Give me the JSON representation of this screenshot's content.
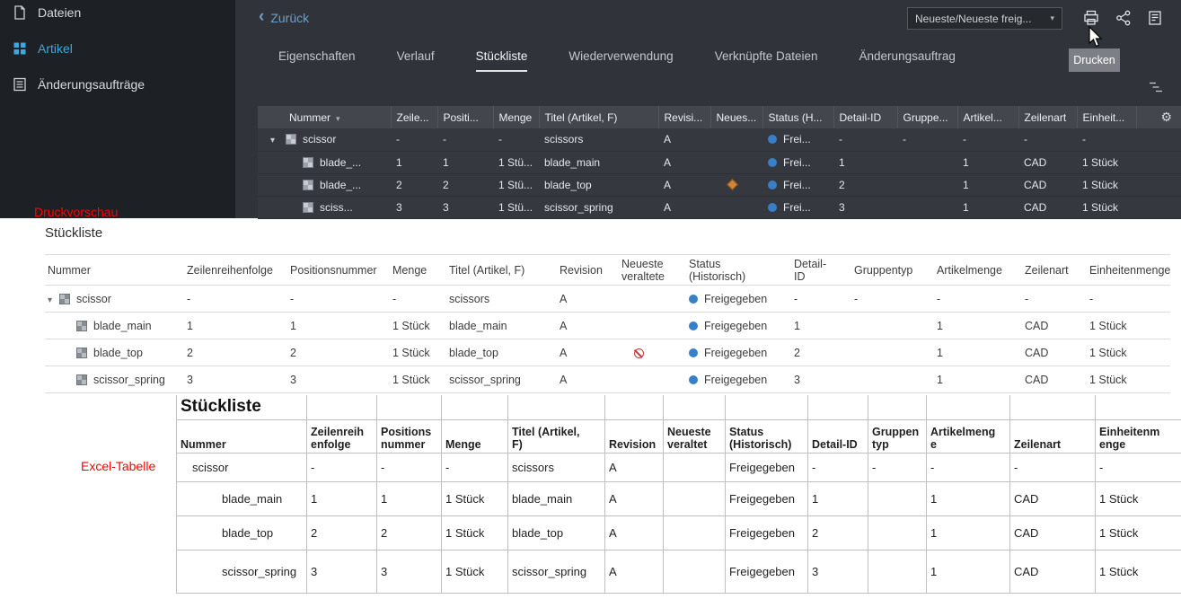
{
  "sidebar": {
    "items": [
      {
        "label": "Dateien"
      },
      {
        "label": "Artikel",
        "active": true
      },
      {
        "label": "Änderungsaufträge"
      }
    ]
  },
  "toolbar": {
    "back_label": "Zurück",
    "revision_rule": "Neueste/Neueste freig...",
    "print_tooltip": "Drucken"
  },
  "tabs": [
    {
      "label": "Eigenschaften"
    },
    {
      "label": "Verlauf"
    },
    {
      "label": "Stückliste",
      "active": true
    },
    {
      "label": "Wiederverwendung"
    },
    {
      "label": "Verknüpfte Dateien"
    },
    {
      "label": "Änderungsauftrag"
    }
  ],
  "annotations": {
    "print_preview_label": "Druckvorschau",
    "excel_label": "Excel-Tabelle"
  },
  "icons": {
    "back_chevron": "‹",
    "caret_down": "▾",
    "gear": "⚙",
    "item": "grid-2x2",
    "status_released": "blue-dot",
    "obsolete_dark": "orange-diamond",
    "obsolete_preview": "red-circle-slash",
    "print": "printer",
    "share": "share-nodes",
    "report": "document-lines",
    "hierarchy_toggle": "tree-lines",
    "cursor": "arrow-pointer"
  },
  "colors": {
    "accent_blue": "#3fa7e0",
    "status_blue": "#377fc7",
    "annotation_red": "#ff0000",
    "obsolete_red": "#c23b3b",
    "obsolete_orange": "#cd853f"
  },
  "bom_table": {
    "columns": [
      "Nummer",
      "Zeile...",
      "Positi...",
      "Menge",
      "Titel (Artikel, F)",
      "Revisi...",
      "Neues...",
      "Status (H...",
      "Detail-ID",
      "Gruppe...",
      "Artikel...",
      "Zeilenart",
      "Einheit..."
    ],
    "rows": [
      {
        "cells": [
          "scissor",
          "-",
          "-",
          "-",
          "scissors",
          "A",
          "",
          "Frei...",
          "-",
          "-",
          "-",
          "-",
          "-"
        ]
      },
      {
        "cells": [
          "blade_...",
          "1",
          "1",
          "1 Stü...",
          "blade_main",
          "A",
          "",
          "Frei...",
          "1",
          "",
          "1",
          "CAD",
          "1 Stück"
        ]
      },
      {
        "cells": [
          "blade_...",
          "2",
          "2",
          "1 Stü...",
          "blade_top",
          "A",
          "",
          "Frei...",
          "2",
          "",
          "1",
          "CAD",
          "1 Stück"
        ]
      },
      {
        "cells": [
          "sciss...",
          "3",
          "3",
          "1 Stü...",
          "scissor_spring",
          "A",
          "",
          "Frei...",
          "3",
          "",
          "1",
          "CAD",
          "1 Stück"
        ]
      }
    ]
  },
  "print_preview": {
    "title": "Stückliste",
    "columns": [
      "Nummer",
      "Zeilenreihenfolge",
      "Positionsnummer",
      "Menge",
      "Titel (Artikel, F)",
      "Revision",
      "Neueste\nveraltete",
      "Status\n(Historisch)",
      "Detail-\nID",
      "Gruppentyp",
      "Artikelmenge",
      "Zeilenart",
      "Einheitenmenge"
    ],
    "rows": [
      {
        "cells": [
          "scissor",
          "-",
          "-",
          "-",
          "scissors",
          "A",
          "",
          "Freigegeben",
          "-",
          "-",
          "-",
          "-",
          "-"
        ]
      },
      {
        "cells": [
          "blade_main",
          "1",
          "1",
          "1 Stück",
          "blade_main",
          "A",
          "",
          "Freigegeben",
          "1",
          "",
          "1",
          "CAD",
          "1 Stück"
        ]
      },
      {
        "cells": [
          "blade_top",
          "2",
          "2",
          "1 Stück",
          "blade_top",
          "A",
          "",
          "Freigegeben",
          "2",
          "",
          "1",
          "CAD",
          "1 Stück"
        ]
      },
      {
        "cells": [
          "scissor_spring",
          "3",
          "3",
          "1 Stück",
          "scissor_spring",
          "A",
          "",
          "Freigegeben",
          "3",
          "",
          "1",
          "CAD",
          "1 Stück"
        ]
      }
    ]
  },
  "excel_table": {
    "title": "Stückliste",
    "columns": [
      "Nummer",
      "Zeilenreih\nenfolge",
      "Positions\nnummer",
      "Menge",
      "Titel (Artikel,\nF)",
      "Revision",
      "Neueste\nveraltet",
      "Status\n(Historisch)",
      "Detail-ID",
      "Gruppen\ntyp",
      "Artikelmeng\ne",
      "Zeilenart",
      "Einheitenm\nenge"
    ],
    "rows": [
      {
        "cells": [
          "scissor",
          "-",
          "-",
          "-",
          "scissors",
          "A",
          "",
          "Freigegeben",
          "-",
          "-",
          "-",
          "-",
          "-"
        ]
      },
      {
        "cells": [
          "blade_main",
          "1",
          "1",
          "1 Stück",
          "blade_main",
          "A",
          "",
          "Freigegeben",
          "1",
          "",
          "1",
          "CAD",
          "1 Stück"
        ]
      },
      {
        "cells": [
          "blade_top",
          "2",
          "2",
          "1 Stück",
          "blade_top",
          "A",
          "",
          "Freigegeben",
          "2",
          "",
          "1",
          "CAD",
          "1 Stück"
        ]
      },
      {
        "cells": [
          "scissor_spring",
          "3",
          "3",
          "1 Stück",
          "scissor_spring",
          "A",
          "",
          "Freigegeben",
          "3",
          "",
          "1",
          "CAD",
          "1 Stück"
        ]
      }
    ]
  }
}
